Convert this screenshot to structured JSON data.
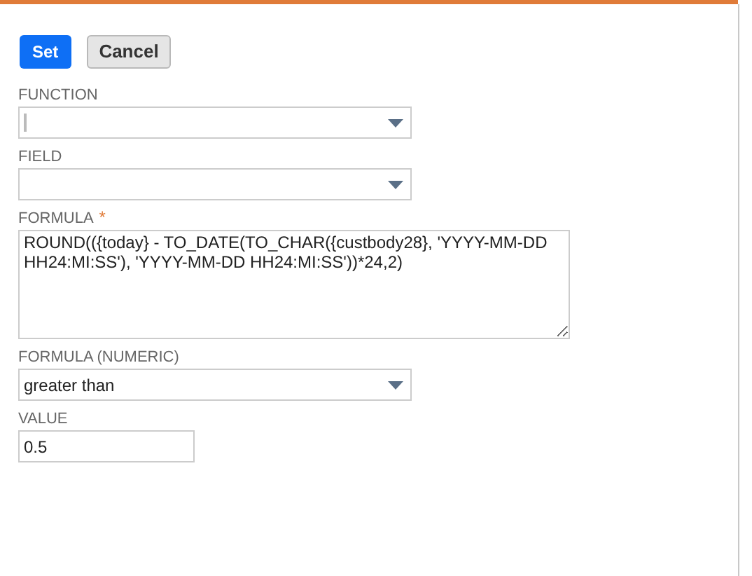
{
  "buttons": [
    {
      "label": "Set",
      "kind": "primary"
    },
    {
      "label": "Cancel",
      "kind": "secondary"
    }
  ],
  "fields": [
    {
      "label": "FUNCTION",
      "kind": "select",
      "focused": true
    },
    {
      "label": "FIELD",
      "kind": "select"
    },
    {
      "label": "FORMULA",
      "kind": "textarea",
      "required_mark": "*",
      "value": "ROUND(({today} - TO_DATE(TO_CHAR({custbody28}, 'YYYY-MM-DD HH24:MI:SS'), 'YYYY-MM-DD HH24:MI:SS'))*24,2)"
    },
    {
      "label": "FORMULA (NUMERIC)",
      "kind": "select",
      "value": "greater than"
    },
    {
      "label": "VALUE",
      "kind": "text",
      "value": "0.5"
    }
  ]
}
